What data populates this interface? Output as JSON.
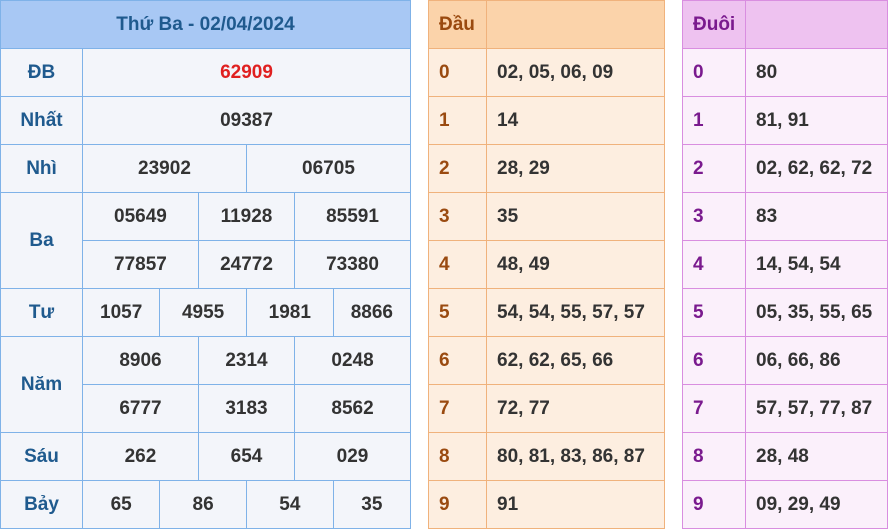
{
  "main": {
    "title": "Thứ Ba - 02/04/2024",
    "prizes": [
      {
        "label": "ĐB",
        "rows": [
          [
            "62909"
          ]
        ]
      },
      {
        "label": "Nhất",
        "rows": [
          [
            "09387"
          ]
        ]
      },
      {
        "label": "Nhì",
        "rows": [
          [
            "23902",
            "06705"
          ]
        ]
      },
      {
        "label": "Ba",
        "rows": [
          [
            "05649",
            "11928",
            "85591"
          ],
          [
            "77857",
            "24772",
            "73380"
          ]
        ]
      },
      {
        "label": "Tư",
        "rows": [
          [
            "1057",
            "4955",
            "1981",
            "8866"
          ]
        ]
      },
      {
        "label": "Năm",
        "rows": [
          [
            "8906",
            "2314",
            "0248"
          ],
          [
            "6777",
            "3183",
            "8562"
          ]
        ]
      },
      {
        "label": "Sáu",
        "rows": [
          [
            "262",
            "654",
            "029"
          ]
        ]
      },
      {
        "label": "Bảy",
        "rows": [
          [
            "65",
            "86",
            "54",
            "35"
          ]
        ]
      }
    ]
  },
  "dau": {
    "header": "Đầu",
    "rows": [
      {
        "k": "0",
        "v": "02, 05, 06, 09"
      },
      {
        "k": "1",
        "v": "14"
      },
      {
        "k": "2",
        "v": "28, 29"
      },
      {
        "k": "3",
        "v": "35"
      },
      {
        "k": "4",
        "v": "48, 49"
      },
      {
        "k": "5",
        "v": "54, 54, 55, 57, 57"
      },
      {
        "k": "6",
        "v": "62, 62, 65, 66"
      },
      {
        "k": "7",
        "v": "72, 77"
      },
      {
        "k": "8",
        "v": "80, 81, 83, 86, 87"
      },
      {
        "k": "9",
        "v": "91"
      }
    ]
  },
  "duoi": {
    "header": "Đuôi",
    "rows": [
      {
        "k": "0",
        "v": "80"
      },
      {
        "k": "1",
        "v": "81, 91"
      },
      {
        "k": "2",
        "v": "02, 62, 62, 72"
      },
      {
        "k": "3",
        "v": "83"
      },
      {
        "k": "4",
        "v": "14, 54, 54"
      },
      {
        "k": "5",
        "v": "05, 35, 55, 65"
      },
      {
        "k": "6",
        "v": "06, 66, 86"
      },
      {
        "k": "7",
        "v": "57, 57, 77, 87"
      },
      {
        "k": "8",
        "v": "28, 48"
      },
      {
        "k": "9",
        "v": "09, 29, 49"
      }
    ]
  },
  "colors": {
    "special_prize": "#e02020",
    "main_header": "#a8c8f4",
    "dau_header": "#fbd3aa",
    "duoi_header": "#eec2f0"
  }
}
